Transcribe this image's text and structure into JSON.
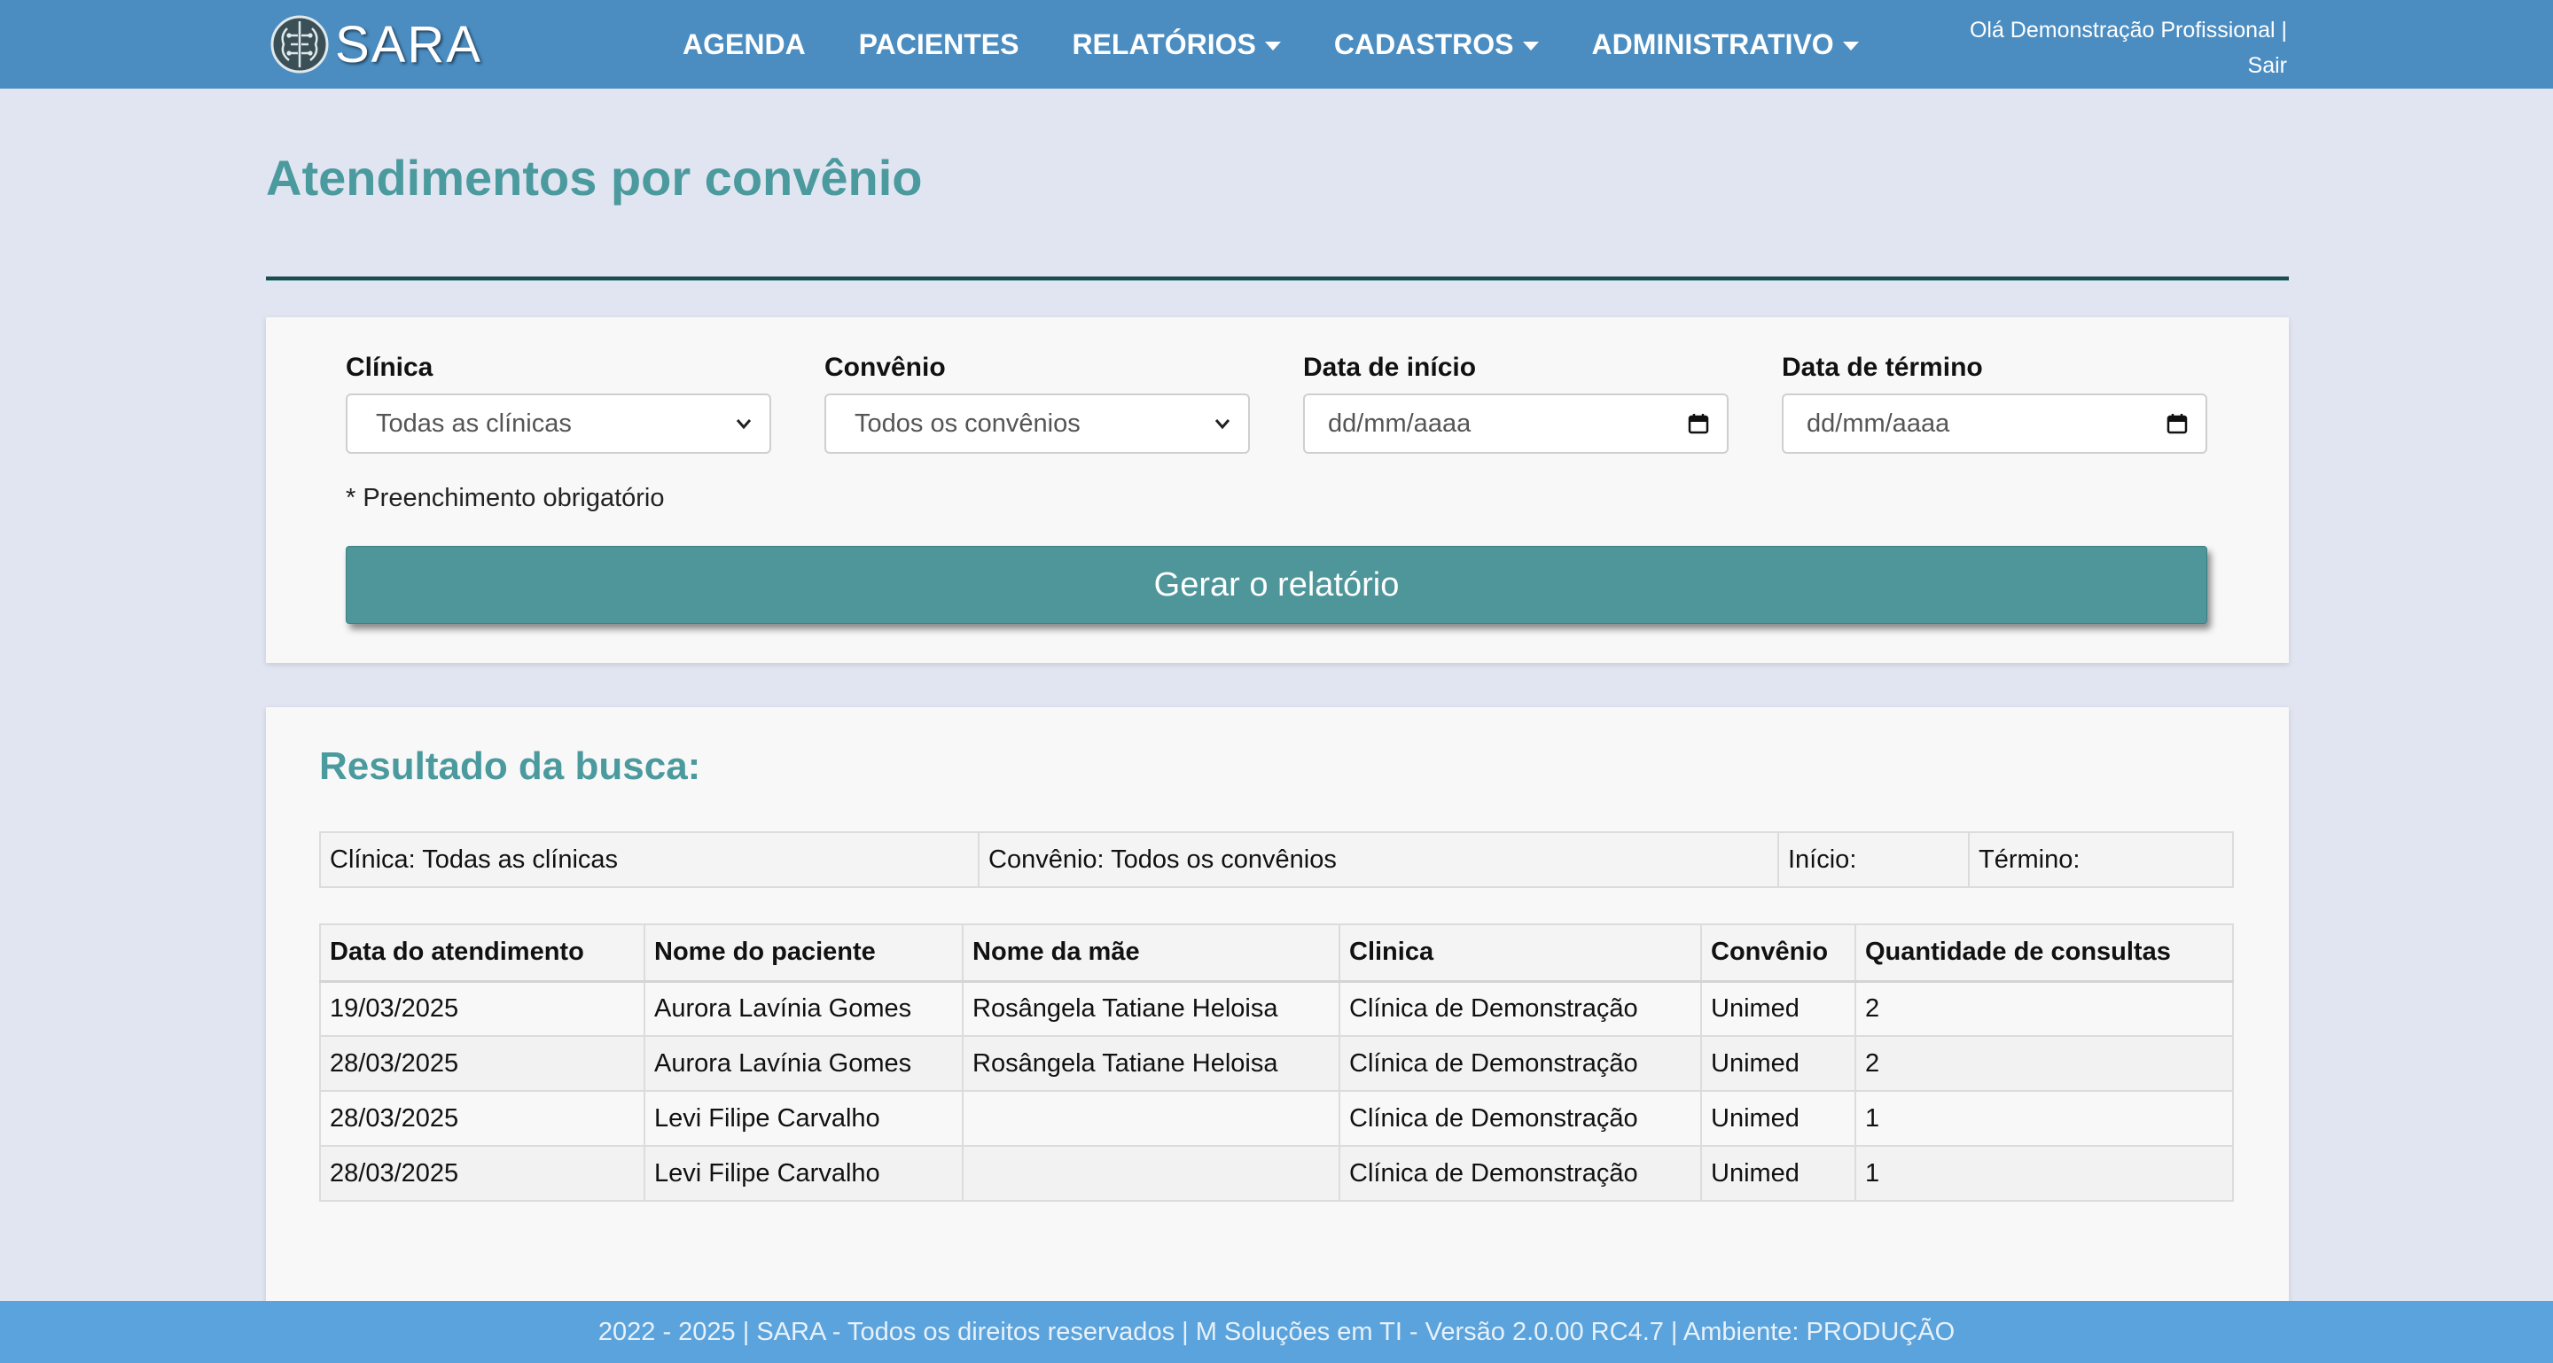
{
  "navbar": {
    "logo_text": "SARA",
    "items": [
      {
        "label": "AGENDA",
        "dropdown": false
      },
      {
        "label": "PACIENTES",
        "dropdown": false
      },
      {
        "label": "RELATÓRIOS",
        "dropdown": true
      },
      {
        "label": "CADASTROS",
        "dropdown": true
      },
      {
        "label": "ADMINISTRATIVO",
        "dropdown": true
      }
    ],
    "greeting": "Olá Demonstração Profissional |",
    "logout": "Sair"
  },
  "page": {
    "title": "Atendimentos por convênio"
  },
  "filters": {
    "clinica": {
      "label": "Clínica",
      "value": "Todas as clínicas"
    },
    "convenio": {
      "label": "Convênio",
      "value": "Todos os convênios"
    },
    "data_inicio": {
      "label": "Data de início",
      "placeholder": "dd/mm/aaaa"
    },
    "data_termino": {
      "label": "Data de término",
      "placeholder": "dd/mm/aaaa"
    },
    "required_note": "* Preenchimento obrigatório",
    "submit_label": "Gerar o relatório"
  },
  "results": {
    "title": "Resultado da busca:",
    "summary": {
      "clinica": "Clínica: Todas as clínicas",
      "convenio": "Convênio: Todos os convênios",
      "inicio": "Início:",
      "termino": "Término:"
    },
    "columns": [
      "Data do atendimento",
      "Nome do paciente",
      "Nome da mãe",
      "Clinica",
      "Convênio",
      "Quantidade de consultas"
    ],
    "rows": [
      [
        "19/03/2025",
        "Aurora Lavínia Gomes",
        "Rosângela Tatiane Heloisa",
        "Clínica de Demonstração",
        "Unimed",
        "2"
      ],
      [
        "28/03/2025",
        "Aurora Lavínia Gomes",
        "Rosângela Tatiane Heloisa",
        "Clínica de Demonstração",
        "Unimed",
        "2"
      ],
      [
        "28/03/2025",
        "Levi Filipe Carvalho",
        "",
        "Clínica de Demonstração",
        "Unimed",
        "1"
      ],
      [
        "28/03/2025",
        "Levi Filipe Carvalho",
        "",
        "Clínica de Demonstração",
        "Unimed",
        "1"
      ]
    ]
  },
  "footer": {
    "text": "2022 - 2025 | SARA - Todos os direitos reservados | M Soluções em TI - Versão 2.0.00 RC4.7 | Ambiente: PRODUÇÃO"
  },
  "colors": {
    "navbar": "#4b8dc1",
    "page_background": "#e1e5f1",
    "accent_teal": "#4a9a9e",
    "button": "#4e969a",
    "footer": "#5aa3dc"
  },
  "icons": {
    "logo": "brain-circuit-icon",
    "dropdown": "caret-down-icon",
    "select": "chevron-down-icon",
    "date": "calendar-icon"
  }
}
